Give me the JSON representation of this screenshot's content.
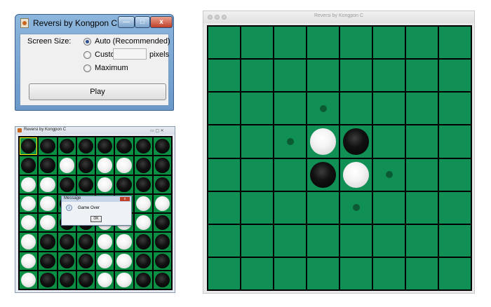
{
  "settings_window": {
    "title": "Reversi by Kongpon C.",
    "screen_size_label": "Screen Size:",
    "options": [
      {
        "label": "Auto (Recommended)",
        "selected": true
      },
      {
        "label": "Custom",
        "selected": false
      },
      {
        "label": "Maximum",
        "selected": false
      }
    ],
    "custom_value": "",
    "pixels_label": "pixels",
    "play_label": "Play",
    "controls": {
      "min": "—",
      "max": "□",
      "close": "x"
    }
  },
  "small_window": {
    "title": "Reversi by Kongpon C",
    "controls": "▭ ▢ ✕",
    "board": [
      "bbbbbbbb",
      "bbwbwwbb",
      "wwbbwbbb",
      "wwbbwbww",
      "wwbbwwwb",
      "wbbbwwbb",
      "wbbbwwbb",
      "wbbbwwbb"
    ],
    "selected_cell": [
      0,
      0
    ],
    "dialog": {
      "title": "Message",
      "text": "Game Over",
      "ok_label": "OK",
      "close_label": "x",
      "info_icon": "i"
    }
  },
  "large_window": {
    "title": "Reversi by Kongpon C",
    "board": [
      "........",
      "........",
      "...h....",
      "..hwb...",
      "...bwh..",
      "....h...",
      "........",
      "........"
    ]
  },
  "colors": {
    "board_green_large": "#109054",
    "board_green_small": "#0b8f43",
    "hint": "#0b5a33"
  }
}
